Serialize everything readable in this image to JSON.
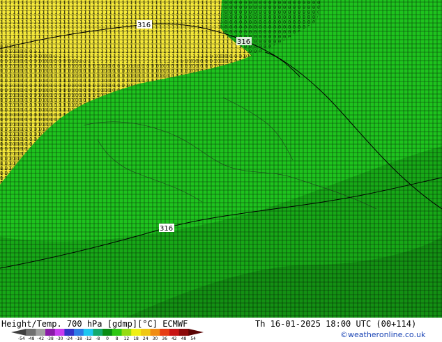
{
  "map": {
    "contour_labels": [
      "316",
      "316",
      "316"
    ],
    "colors": {
      "warm_zone": "#f5e93a",
      "cold_zone": "#1ec31e",
      "dark_zone": "#17a817",
      "number_grid": "#000000",
      "contour": "#000000"
    }
  },
  "footer": {
    "title": "Height/Temp. 700 hPa [gdmp][°C] ECMWF",
    "datetime": "Th 16-01-2025 18:00 UTC (00+114)",
    "credit": "©weatheronline.co.uk"
  },
  "legend": {
    "ticks": [
      "-54",
      "-48",
      "-42",
      "-38",
      "-30",
      "-24",
      "-18",
      "-12",
      "-8",
      "0",
      "8",
      "12",
      "18",
      "24",
      "30",
      "36",
      "42",
      "48",
      "54"
    ],
    "colors": [
      "#404040",
      "#707070",
      "#a0a0a0",
      "#8a1aa8",
      "#c83cf0",
      "#3232c8",
      "#2d7de6",
      "#1ec8f0",
      "#14aa6e",
      "#0a8c14",
      "#2dc814",
      "#96dc14",
      "#f0f014",
      "#f0c814",
      "#f08c14",
      "#e63c14",
      "#c81414",
      "#8c0a0a",
      "#5a0505"
    ]
  }
}
